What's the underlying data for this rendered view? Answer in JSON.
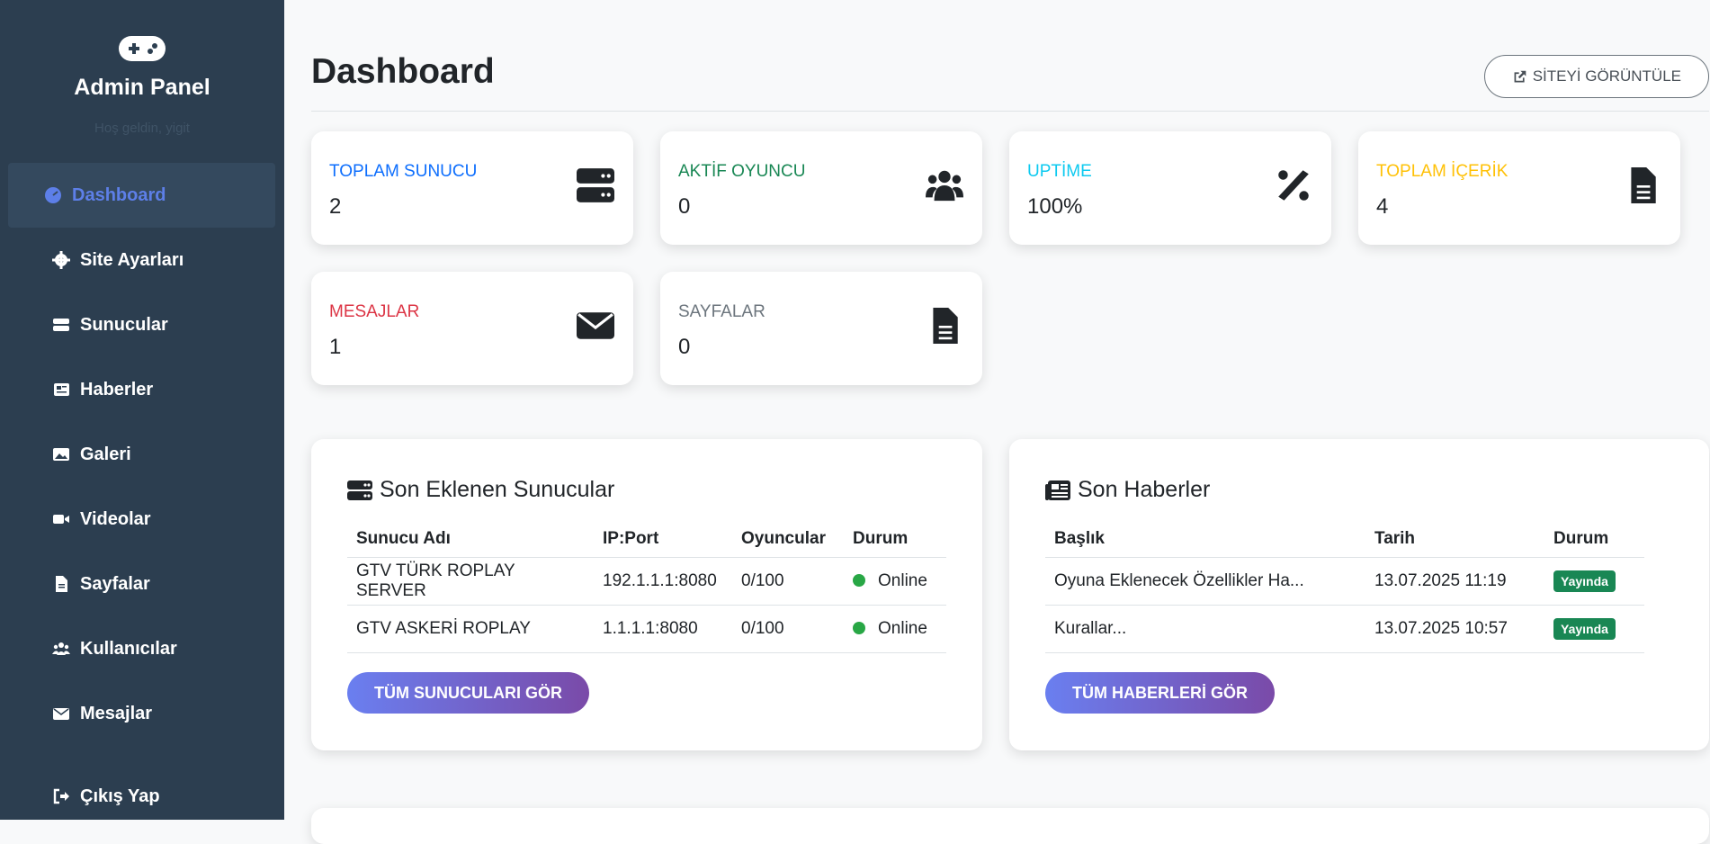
{
  "sidebar": {
    "title": "Admin Panel",
    "subtitle": "Hoş geldin, yigit",
    "brand_icon": "gamepad-icon",
    "items": [
      {
        "label": "Dashboard",
        "icon": "dashboard-icon",
        "active": true
      },
      {
        "label": "Site Ayarları",
        "icon": "gear-icon"
      },
      {
        "label": "Sunucular",
        "icon": "server-icon"
      },
      {
        "label": "Haberler",
        "icon": "newspaper-icon"
      },
      {
        "label": "Galeri",
        "icon": "images-icon"
      },
      {
        "label": "Videolar",
        "icon": "video-icon"
      },
      {
        "label": "Sayfalar",
        "icon": "file-icon"
      },
      {
        "label": "Kullanıcılar",
        "icon": "users-icon"
      },
      {
        "label": "Mesajlar",
        "icon": "envelope-icon"
      }
    ],
    "logout_label": "Çıkış Yap"
  },
  "header": {
    "title": "Dashboard",
    "view_site_label": "SİTEYİ GÖRÜNTÜLE"
  },
  "stats": [
    {
      "label": "TOPLAM SUNUCU",
      "value": "2",
      "color": "#0d6efd",
      "icon": "server-icon"
    },
    {
      "label": "AKTİF OYUNCU",
      "value": "0",
      "color": "#198754",
      "icon": "users-icon"
    },
    {
      "label": "UPTİME",
      "value": "100%",
      "color": "#0dcaf0",
      "icon": "percent-icon"
    },
    {
      "label": "TOPLAM İÇERİK",
      "value": "4",
      "color": "#ffc107",
      "icon": "file-icon"
    },
    {
      "label": "MESAJLAR",
      "value": "1",
      "color": "#dc3545",
      "icon": "envelope-icon"
    },
    {
      "label": "SAYFALAR",
      "value": "0",
      "color": "#6c757d",
      "icon": "file-icon"
    }
  ],
  "servers_panel": {
    "title": "Son Eklenen Sunucular",
    "columns": [
      "Sunucu Adı",
      "IP:Port",
      "Oyuncular",
      "Durum"
    ],
    "rows": [
      {
        "name": "GTV TÜRK ROPLAY SERVER",
        "ip": "192.1.1.1:8080",
        "players": "0/100",
        "status": "Online"
      },
      {
        "name": "GTV ASKERİ ROPLAY",
        "ip": "1.1.1.1:8080",
        "players": "0/100",
        "status": "Online"
      }
    ],
    "button_label": "TÜM SUNUCULARI GÖR"
  },
  "news_panel": {
    "title": "Son Haberler",
    "columns": [
      "Başlık",
      "Tarih",
      "Durum"
    ],
    "rows": [
      {
        "title": "Oyuna Eklenecek Özellikler Ha...",
        "date": "13.07.2025 11:19",
        "status": "Yayında"
      },
      {
        "title": "Kurallar...",
        "date": "13.07.2025 10:57",
        "status": "Yayında"
      }
    ],
    "button_label": "TÜM HABERLERİ GÖR"
  },
  "colors": {
    "sidebar_bg": "#2c3e50",
    "accent": "#5d7fe8",
    "online": "#28a745",
    "published": "#198754"
  }
}
